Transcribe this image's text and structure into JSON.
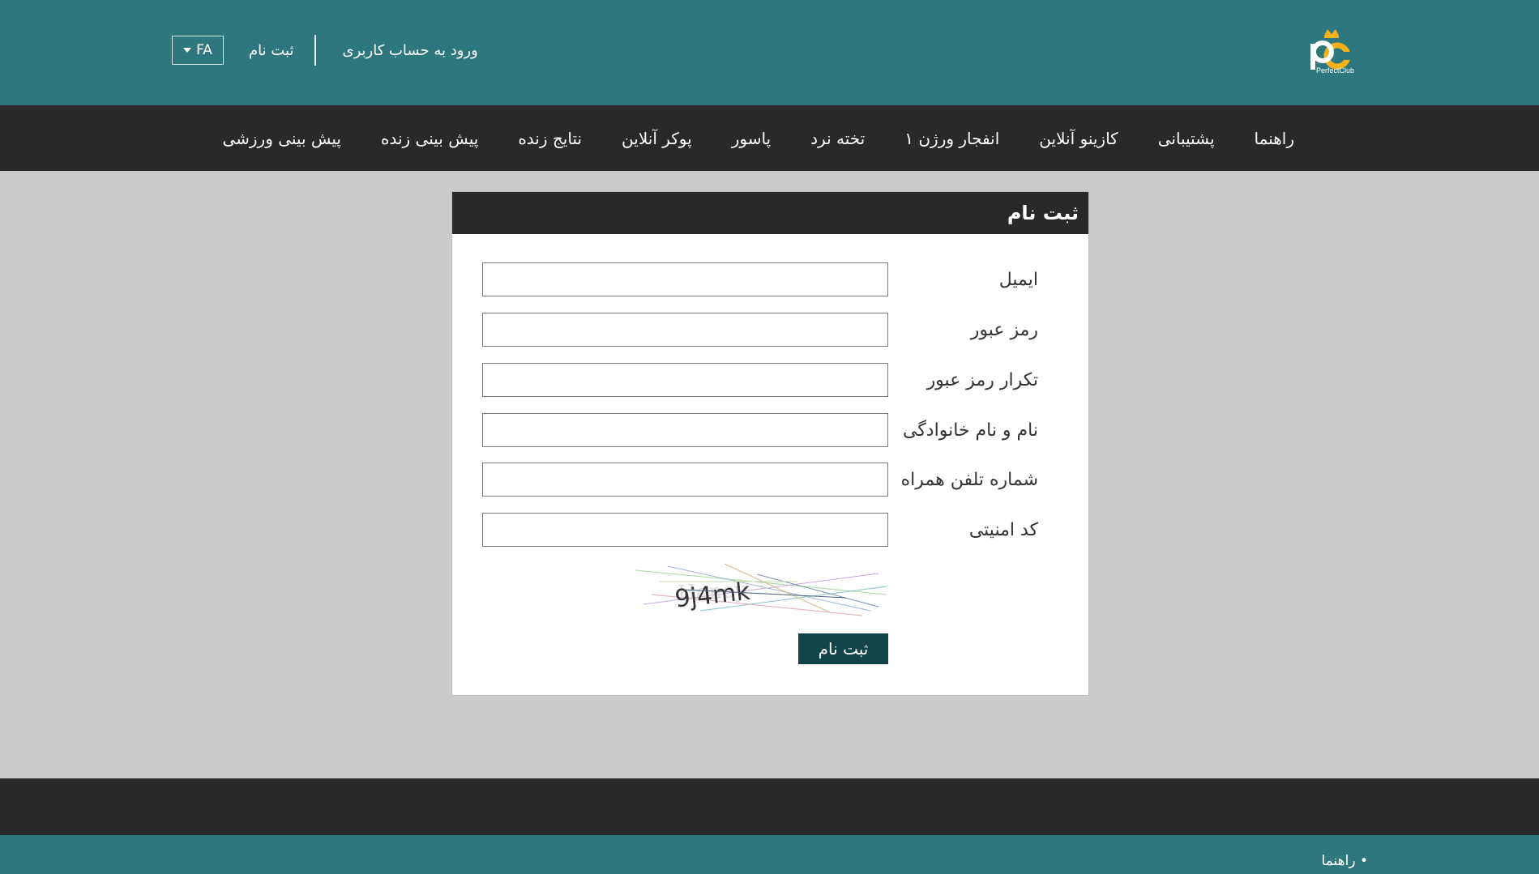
{
  "header": {
    "logo_text": "PerfectClub",
    "login_label": "ورود به حساب کاربری",
    "register_label": "ثبت نام",
    "language_label": "FA",
    "colors": {
      "teal": "#2e777e",
      "dark": "#292929"
    }
  },
  "nav": {
    "items": [
      {
        "label": "پیش بینی ورزشی"
      },
      {
        "label": "پیش بینی زنده"
      },
      {
        "label": "نتایج زنده"
      },
      {
        "label": "پوکر آنلاین"
      },
      {
        "label": "پاسور"
      },
      {
        "label": "تخته نرد"
      },
      {
        "label": "انفجار ورژن ۱"
      },
      {
        "label": "کازینو آنلاین"
      },
      {
        "label": "پشتیبانی"
      },
      {
        "label": "راهنما"
      }
    ]
  },
  "form": {
    "title": "ثبت نام",
    "fields": [
      {
        "label": "ایمیل",
        "value": ""
      },
      {
        "label": "رمز عبور",
        "value": ""
      },
      {
        "label": "تکرار رمز عبور",
        "value": ""
      },
      {
        "label": "نام و نام خانوادگی",
        "value": ""
      },
      {
        "label": "شماره تلفن همراه",
        "value": ""
      },
      {
        "label": "کد امنیتی",
        "value": ""
      }
    ],
    "captcha_text": "9j4mk",
    "submit_label": "ثبت نام"
  },
  "footer": {
    "link_label": "• راهنما"
  }
}
